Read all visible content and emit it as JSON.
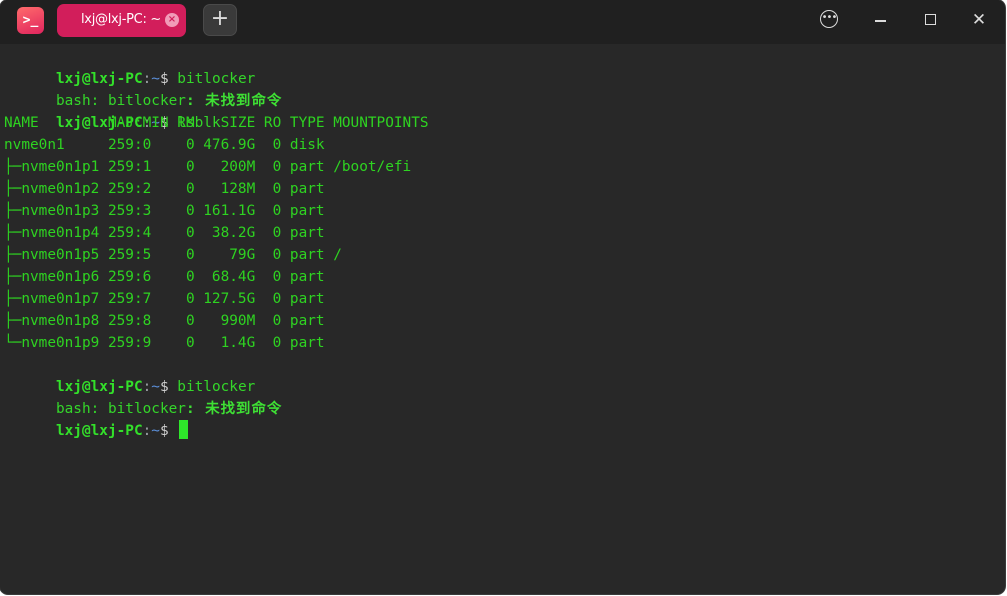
{
  "titlebar": {
    "tab_label": "lxj@lxj-PC: ~",
    "tab_close": "×",
    "new_tab": "+",
    "app_icon_glyph": ">_",
    "icons": {
      "app": "terminal-icon",
      "close_tab": "close-icon",
      "new_tab": "plus-icon",
      "menu": "more-icon",
      "minimize": "minimize-icon",
      "maximize": "maximize-icon",
      "close_window": "close-icon"
    },
    "close_glyph": "✕",
    "menu_glyph": "•••"
  },
  "colors": {
    "window_bg": "#282828",
    "titlebar_bg": "#202020",
    "tab_active": "#d21e5b",
    "text_green": "#2ed321",
    "path_blue": "#5b8fd9"
  },
  "prompt": {
    "user_host": "lxj@lxj-PC",
    "sep": ":",
    "path": "~",
    "symbol": "$"
  },
  "terminal": {
    "cmd1": " bitlocker",
    "err1_prefix": "bash: bitlocker",
    "err1_msg": ": 未找到命令",
    "cmd2": " lsblk",
    "lsblk_header": "NAME        MAJ:MIN RM   SIZE RO TYPE MOUNTPOINTS",
    "lsblk_rows": [
      "nvme0n1     259:0    0 476.9G  0 disk",
      "├─nvme0n1p1 259:1    0   200M  0 part /boot/efi",
      "├─nvme0n1p2 259:2    0   128M  0 part",
      "├─nvme0n1p3 259:3    0 161.1G  0 part",
      "├─nvme0n1p4 259:4    0  38.2G  0 part",
      "├─nvme0n1p5 259:5    0    79G  0 part /",
      "├─nvme0n1p6 259:6    0  68.4G  0 part",
      "├─nvme0n1p7 259:7    0 127.5G  0 part",
      "├─nvme0n1p8 259:8    0   990M  0 part",
      "└─nvme0n1p9 259:9    0   1.4G  0 part"
    ],
    "cmd3": " bitlocker",
    "err2_prefix": "bash: bitlocker",
    "err2_msg": ": 未找到命令",
    "cmd4": " "
  }
}
